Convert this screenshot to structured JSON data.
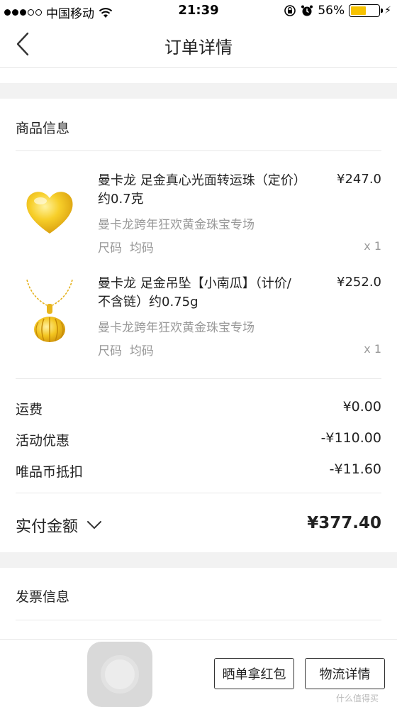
{
  "status_bar": {
    "carrier": "中国移动",
    "time": "21:39",
    "battery_percent": "56%",
    "battery_level": 0.56,
    "signal_bars": 3
  },
  "nav": {
    "title": "订单详情",
    "back_icon": "chevron-left-icon"
  },
  "goods": {
    "section_title": "商品信息",
    "items": [
      {
        "name": "曼卡龙 足金真心光面转运珠（定价）约0.7克",
        "price": "¥247.0",
        "shop": "曼卡龙跨年狂欢黄金珠宝专场",
        "size_label": "尺码",
        "size_value": "均码",
        "qty": "x 1",
        "image_icon": "gold-heart-bead-icon"
      },
      {
        "name": "曼卡龙 足金吊坠【小南瓜】（计价/不含链）约0.75g",
        "price": "¥252.0",
        "shop": "曼卡龙跨年狂欢黄金珠宝专场",
        "size_label": "尺码",
        "size_value": "均码",
        "qty": "x 1",
        "image_icon": "gold-pumpkin-pendant-icon"
      }
    ]
  },
  "fees": [
    {
      "label": "运费",
      "value": "¥0.00"
    },
    {
      "label": "活动优惠",
      "value": "-¥110.00"
    },
    {
      "label": "唯品币抵扣",
      "value": "-¥11.60"
    }
  ],
  "paid": {
    "label": "实付金额",
    "value": "¥377.40"
  },
  "invoice": {
    "section_title": "发票信息"
  },
  "bottom": {
    "share_button": "晒单拿红包",
    "logistics_button": "物流详情",
    "watermark": "什么值得买"
  },
  "colors": {
    "gold": "#f3c51f",
    "band": "#f2f2f2",
    "muted_text": "#999999"
  }
}
